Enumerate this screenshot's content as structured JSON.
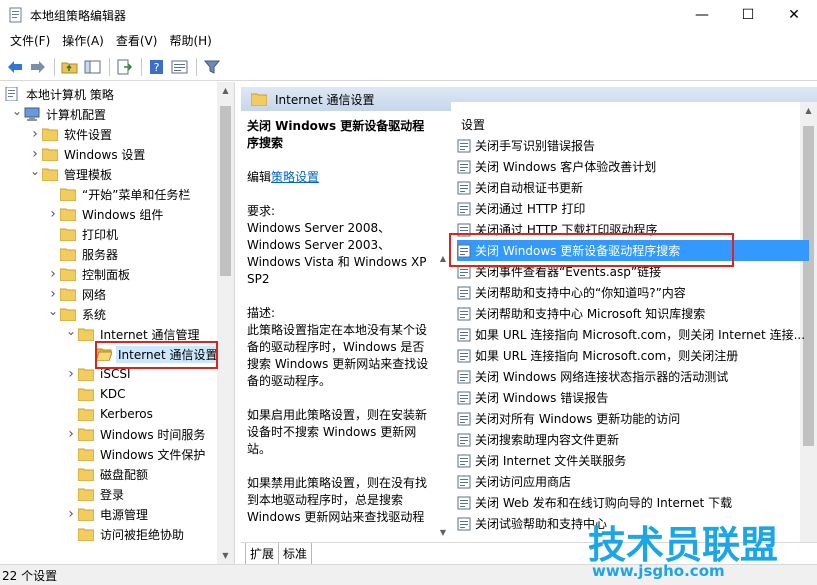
{
  "window": {
    "title": "本地组策略编辑器",
    "minimize_glyph": "—",
    "maximize_glyph": "☐",
    "close_glyph": "✕"
  },
  "menu": [
    "文件(F)",
    "操作(A)",
    "查看(V)",
    "帮助(H)"
  ],
  "toolbar": {
    "icons": [
      "back-arrow-icon",
      "forward-arrow-icon",
      "up-folder-icon",
      "show-hide-tree-icon",
      "export-list-icon",
      "help-icon",
      "properties-icon",
      "filter-icon"
    ]
  },
  "tree": {
    "items": [
      {
        "label": "本地计算机 策略",
        "level": 0,
        "expanded": null,
        "icon": "policy-icon"
      },
      {
        "label": "计算机配置",
        "level": 1,
        "expanded": true,
        "icon": "computer-icon"
      },
      {
        "label": "软件设置",
        "level": 2,
        "expanded": false,
        "icon": "folder-icon"
      },
      {
        "label": "Windows 设置",
        "level": 2,
        "expanded": false,
        "icon": "folder-icon"
      },
      {
        "label": "管理模板",
        "level": 2,
        "expanded": true,
        "icon": "folder-icon"
      },
      {
        "label": "“开始”菜单和任务栏",
        "level": 3,
        "expanded": null,
        "icon": "folder-icon"
      },
      {
        "label": "Windows 组件",
        "level": 3,
        "expanded": false,
        "icon": "folder-icon"
      },
      {
        "label": "打印机",
        "level": 3,
        "expanded": null,
        "icon": "folder-icon"
      },
      {
        "label": "服务器",
        "level": 3,
        "expanded": null,
        "icon": "folder-icon"
      },
      {
        "label": "控制面板",
        "level": 3,
        "expanded": false,
        "icon": "folder-icon"
      },
      {
        "label": "网络",
        "level": 3,
        "expanded": false,
        "icon": "folder-icon"
      },
      {
        "label": "系统",
        "level": 3,
        "expanded": true,
        "icon": "folder-icon"
      },
      {
        "label": "Internet 通信管理",
        "level": 4,
        "expanded": true,
        "icon": "folder-icon"
      },
      {
        "label": "Internet 通信设置",
        "level": 5,
        "expanded": null,
        "icon": "folder-open-icon",
        "selected": true
      },
      {
        "label": "iSCSI",
        "level": 4,
        "expanded": false,
        "icon": "folder-icon"
      },
      {
        "label": "KDC",
        "level": 4,
        "expanded": null,
        "icon": "folder-icon"
      },
      {
        "label": "Kerberos",
        "level": 4,
        "expanded": null,
        "icon": "folder-icon"
      },
      {
        "label": "Windows 时间服务",
        "level": 4,
        "expanded": false,
        "icon": "folder-icon"
      },
      {
        "label": "Windows 文件保护",
        "level": 4,
        "expanded": null,
        "icon": "folder-icon"
      },
      {
        "label": "磁盘配额",
        "level": 4,
        "expanded": null,
        "icon": "folder-icon"
      },
      {
        "label": "登录",
        "level": 4,
        "expanded": null,
        "icon": "folder-icon"
      },
      {
        "label": "电源管理",
        "level": 4,
        "expanded": false,
        "icon": "folder-icon"
      },
      {
        "label": "访问被拒绝协助",
        "level": 4,
        "expanded": null,
        "icon": "folder-icon"
      }
    ]
  },
  "right": {
    "header_title": "Internet 通信设置",
    "description": {
      "title": "关闭 Windows 更新设备驱动程序搜索",
      "edit_prefix": "编辑",
      "edit_link": "策略设置",
      "requirements_label": "要求:",
      "requirements": "Windows Server 2008、Windows Server 2003、Windows Vista 和 Windows XP SP2",
      "desc_label": "描述:",
      "desc": "此策略设置指定在本地没有某个设备的驱动程序时，Windows 是否搜索 Windows 更新网站来查找设备的驱动程序。",
      "enabled": "如果启用此策略设置，则在安装新设备时不搜索 Windows 更新网站。",
      "disabled": "如果禁用此策略设置，则在没有找到本地驱动程序时，总是搜索 Windows 更新网站来查找驱动程"
    },
    "list_header": "设置",
    "settings": [
      "关闭手写识别错误报告",
      "关闭 Windows 客户体验改善计划",
      "关闭自动根证书更新",
      "关闭通过 HTTP 打印",
      "关闭通过 HTTP 下载打印驱动程序",
      "关闭 Windows 更新设备驱动程序搜索",
      "关闭事件查看器“Events.asp”链接",
      "关闭帮助和支持中心的“你知道吗?”内容",
      "关闭帮助和支持中心 Microsoft 知识库搜索",
      "如果 URL 连接指向 Microsoft.com，则关闭 Internet 连接...",
      "如果 URL 连接指向 Microsoft.com，则关闭注册",
      "关闭 Windows 网络连接状态指示器的活动测试",
      "关闭 Windows 错误报告",
      "关闭对所有 Windows 更新功能的访问",
      "关闭搜索助理内容文件更新",
      "关闭 Internet 文件关联服务",
      "关闭访问应用商店",
      "关闭 Web 发布和在线订购向导的 Internet 下载",
      "关闭试验帮助和支持中心"
    ],
    "selected_index": 5,
    "tabs": [
      "扩展",
      "标准"
    ]
  },
  "status": {
    "text": "22 个设置"
  },
  "watermark": {
    "text": "技术员联盟",
    "url": "www.jsgho.com"
  },
  "colors": {
    "selection": "#3399ff",
    "highlight_box": "#e2231a",
    "link": "#0066cc",
    "watermark": "#1ca6e6"
  }
}
